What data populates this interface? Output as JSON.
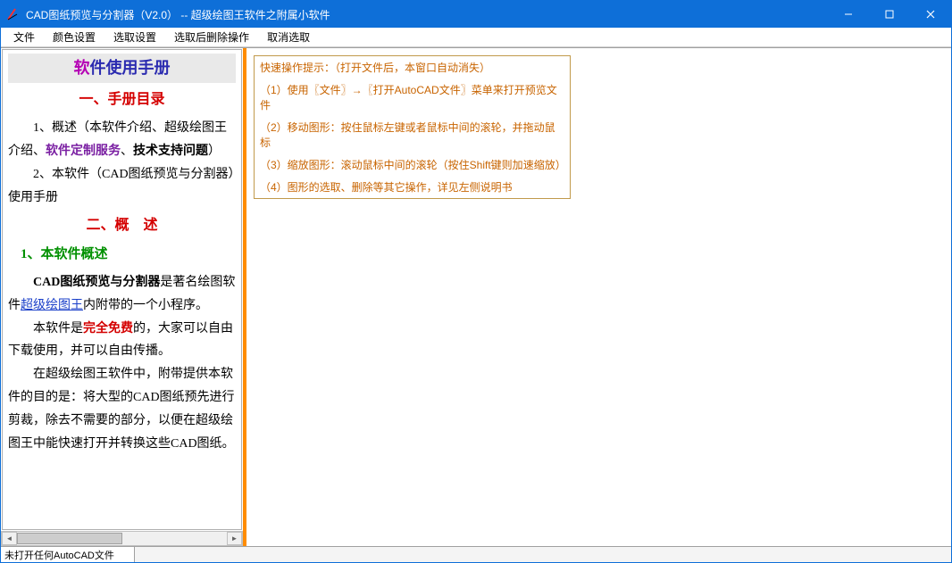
{
  "titlebar": {
    "title": "CAD图纸预览与分割器（V2.0） -- 超级绘图王软件之附属小软件"
  },
  "menu": {
    "items": [
      "文件",
      "颜色设置",
      "选取设置",
      "选取后删除操作",
      "取消选取"
    ]
  },
  "manual": {
    "heading_first": "软",
    "heading_rest": "件使用手册",
    "toc_title": "一、手册目录",
    "toc_item1_pre": "1、概述（本软件介绍、超级绘图王介绍、",
    "toc_item1_svc": "软件定制服务",
    "toc_item1_mid": "、",
    "toc_item1_support": "技术支持问题",
    "toc_item1_post": "）",
    "toc_item2": "2、本软件（CAD图纸预览与分割器）使用手册",
    "sec2_title": "二、概　述",
    "sec2_sub1": "1、本软件概述",
    "p1_bold": "CAD图纸预览与分割器",
    "p1_rest1": "是著名绘图软件",
    "p1_link": "超级绘图王",
    "p1_rest2": "内附带的一个小程序。",
    "p2_pre": "本软件是",
    "p2_red": "完全免费",
    "p2_post": "的，大家可以自由下载使用，并可以自由传播。",
    "p3": "在超级绘图王软件中，附带提供本软件的目的是：将大型的CAD图纸预先进行剪裁，除去不需要的部分，以便在超级绘图王中能快速打开并转换这些CAD图纸。"
  },
  "tips": {
    "header": "快速操作提示：（打开文件后，本窗口自动消失）",
    "rows": [
      "（1）使用〖文件〗→〖打开AutoCAD文件〗菜单来打开预览文件",
      "（2）移动图形：按住鼠标左键或者鼠标中间的滚轮，并拖动鼠标",
      "（3）缩放图形：滚动鼠标中间的滚轮（按住Shift键则加速缩放）",
      "（4）图形的选取、删除等其它操作，详见左侧说明书"
    ]
  },
  "statusbar": {
    "text": "未打开任何AutoCAD文件"
  }
}
